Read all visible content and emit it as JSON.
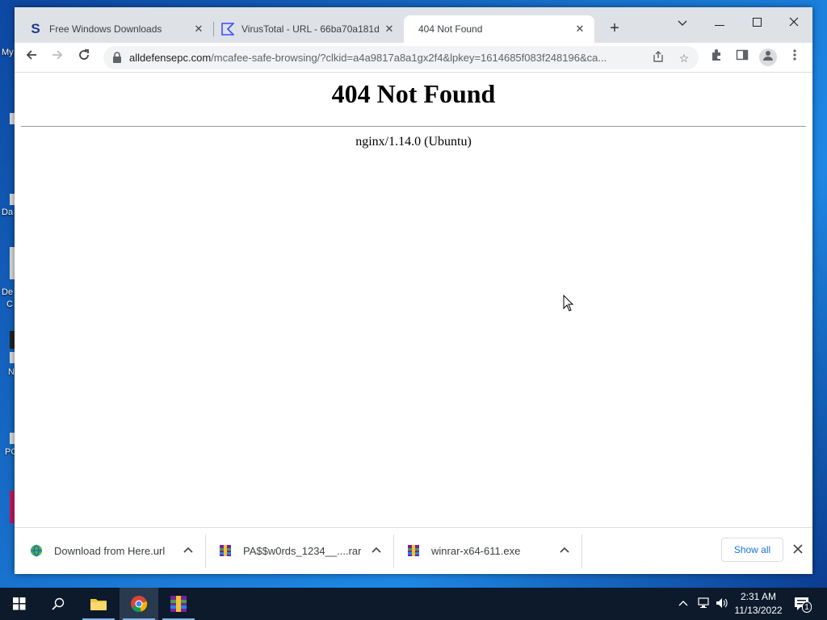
{
  "desktop": {
    "labels": [
      "My",
      "Da",
      "De",
      "C",
      "N",
      "PC"
    ]
  },
  "browser": {
    "tabs": [
      {
        "title": "Free Windows Downloads",
        "icon": "softpedia-s-icon",
        "active": false
      },
      {
        "title": "VirusTotal - URL - 66ba70a181d",
        "icon": "virustotal-icon",
        "active": false
      },
      {
        "title": "404 Not Found",
        "icon": "",
        "active": true
      }
    ],
    "url_host": "alldefensepc.com",
    "url_path": "/mcafee-safe-browsing/?clkid=a4a9817a8a1gx2f4&lpkey=1614685f083f248196&ca..."
  },
  "page": {
    "heading": "404 Not Found",
    "server": "nginx/1.14.0 (Ubuntu)"
  },
  "downloads": {
    "items": [
      {
        "name": "Download from Here.url",
        "icon": "internet-shortcut-icon"
      },
      {
        "name": "PA$$w0rds_1234__....rar",
        "icon": "winrar-archive-icon"
      },
      {
        "name": "winrar-x64-611.exe",
        "icon": "winrar-installer-icon"
      }
    ],
    "show_all": "Show all"
  },
  "taskbar": {
    "time": "2:31 AM",
    "date": "11/13/2022",
    "notification_count": "1"
  },
  "colors": {
    "accent": "#1a73e8",
    "taskbar": "#0c1a2b",
    "tabstrip": "#dee1e6"
  }
}
